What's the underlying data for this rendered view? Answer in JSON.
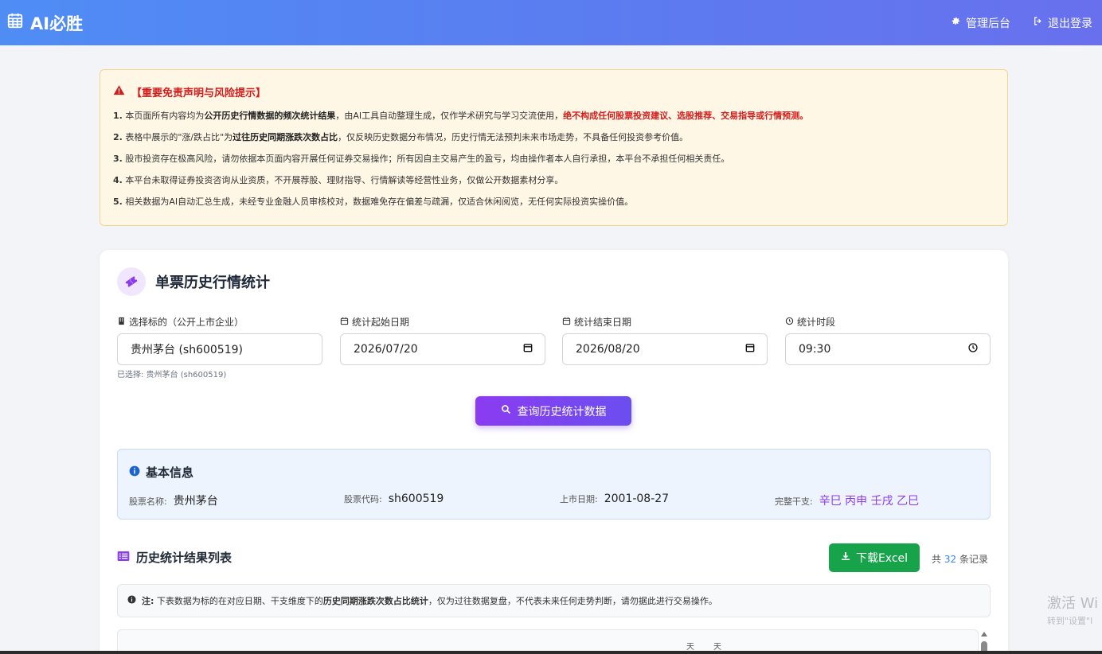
{
  "header": {
    "brand": "AI必胜",
    "admin_label": "管理后台",
    "logout_label": "退出登录"
  },
  "disclaimer": {
    "title": "【重要免责声明与风险提示】",
    "lines": [
      {
        "num": "1.",
        "a": " 本页面所有内容均为",
        "b": "公开历史行情数据的频次统计结果",
        "c": "，由AI工具自动整理生成，仅作学术研究与学习交流使用，",
        "d": "绝不构成任何股票投资建议、选股推荐、交易指导或行情预测。"
      },
      {
        "num": "2.",
        "a": " 表格中展示的\"涨/跌占比\"为",
        "b": "过往历史同期涨跌次数占比",
        "c": "，仅反映历史数据分布情况，历史行情无法预判未来市场走势，不具备任何投资参考价值。"
      },
      {
        "num": "3.",
        "a": " 股市投资存在极高风险，请勿依据本页面内容开展任何证券交易操作；所有因自主交易产生的盈亏，均由操作者本人自行承担，本平台不承担任何相关责任。"
      },
      {
        "num": "4.",
        "a": " 本平台未取得证券投资咨询从业资质，不开展荐股、理财指导、行情解读等经营性业务，仅做公开数据素材分享。"
      },
      {
        "num": "5.",
        "a": " 相关数据为AI自动汇总生成，未经专业金融人员审核校对，数据难免存在偏差与疏漏，仅适合休闲阅览，无任何实际投资实操价值。"
      }
    ]
  },
  "card": {
    "title": "单票历史行情统计",
    "fields": {
      "stock_label": "选择标的（公开上市企业）",
      "stock_value": "贵州茅台 (sh600519)",
      "start_label": "统计起始日期",
      "start_value": "2026/07/20",
      "end_label": "统计结束日期",
      "end_value": "2026/08/20",
      "time_label": "统计时段",
      "time_value": "09:30"
    },
    "selected_hint": "已选择: 贵州茅台 (sh600519)",
    "query_button": "查询历史统计数据"
  },
  "basic_info": {
    "title": "基本信息",
    "name_label": "股票名称:",
    "name_value": "贵州茅台",
    "code_label": "股票代码:",
    "code_value": "sh600519",
    "list_label": "上市日期:",
    "list_value": "2001-08-27",
    "ganzhi_label": "完整干支:",
    "ganzhi_value": "辛巳 丙申 壬戌 乙巳"
  },
  "results": {
    "title": "历史统计结果列表",
    "excel_button": "下载Excel",
    "count_prefix": "共",
    "count": "32",
    "count_suffix": "条记录",
    "note_label": "注:",
    "note_a": " 下表数据为标的在对应日期、干支维度下的",
    "note_b": "历史同期涨跌次数占比统计",
    "note_c": "，仅为过往数据复盘，不代表未来任何走势判断，请勿据此进行交易操作。",
    "header_cells": [
      "天",
      "天"
    ]
  },
  "watermark": {
    "line1": "激活 Wi",
    "line2": "转到\"设置\"l"
  },
  "colors": {
    "header_gradient_start": "#4f8df5",
    "header_gradient_end": "#6870ee",
    "danger": "#d21d1d",
    "primary_purple": "#8b3cf0",
    "excel_green": "#16a34a",
    "link_blue": "#3b82f6"
  }
}
